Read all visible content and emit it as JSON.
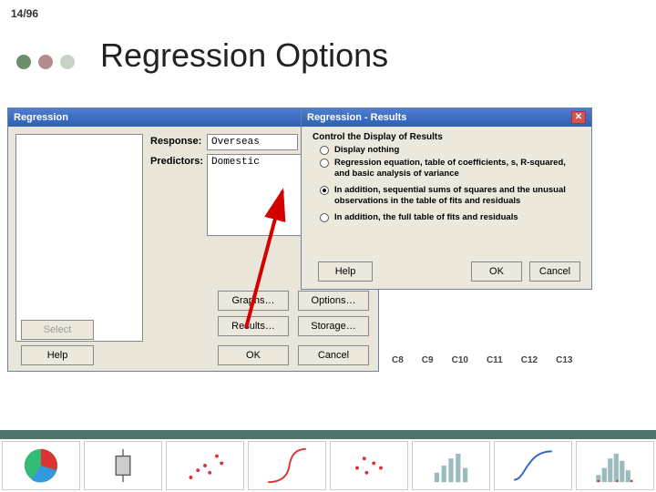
{
  "slide": {
    "counter": "14/96",
    "title": "Regression Options"
  },
  "regression_window": {
    "title": "Regression",
    "labels": {
      "response": "Response:",
      "predictors": "Predictors:"
    },
    "response_value": "Overseas",
    "predictors_value": "Domestic",
    "buttons": {
      "select": "Select",
      "help": "Help",
      "graphs": "Graphs…",
      "results": "Results…",
      "ok": "OK",
      "options": "Options…",
      "storage": "Storage…",
      "cancel": "Cancel"
    }
  },
  "results_dialog": {
    "title": "Regression - Results",
    "group_title": "Control the Display of Results",
    "options": [
      "Display nothing",
      "Regression equation, table of coefficients, s, R-squared, and basic analysis of variance",
      "In addition, sequential sums of squares and the unusual observations in the table of fits and residuals",
      "In addition, the full table of fits and residuals"
    ],
    "selected_index": 2,
    "buttons": {
      "help": "Help",
      "ok": "OK",
      "cancel": "Cancel"
    }
  },
  "spreadsheet_cols": [
    "C8",
    "C9",
    "C10",
    "C11",
    "C12",
    "C13"
  ],
  "thumb_labels": [
    "pie",
    "box",
    "scatter1",
    "curve",
    "scatter2",
    "bars",
    "sigmoid",
    "hist"
  ]
}
